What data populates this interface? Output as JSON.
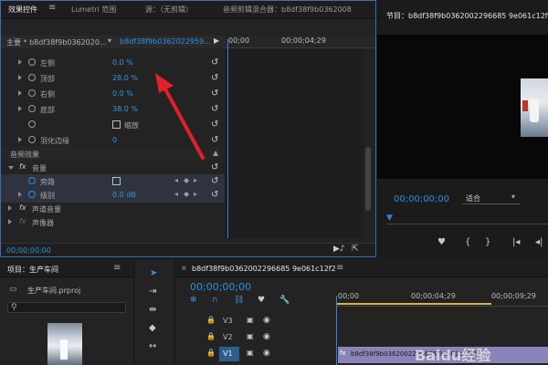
{
  "effect_controls": {
    "tabs": [
      "效果控件",
      "Lumetri 范围",
      "源：（无剪辑）",
      "音频剪辑混合器：b8df38f9b0362008"
    ],
    "header_master": "主要 * b8df38f9b0362020...",
    "header_clip": "b8df38f9b0362022959...",
    "ruler_start": "00;00",
    "ruler_mid": "00;00;04;29",
    "rows": [
      {
        "label": "左侧",
        "value": "0.0 %"
      },
      {
        "label": "顶部",
        "value": "28.0 %"
      },
      {
        "label": "右侧",
        "value": "0.0 %"
      },
      {
        "label": "底部",
        "value": "38.0 %"
      },
      {
        "label": "",
        "checkbox": "缩放"
      },
      {
        "label": "羽化边缘",
        "value": "0"
      }
    ],
    "audio_section": "音频效果",
    "volume": {
      "label": "音量",
      "bypass": "旁路",
      "level": "级别",
      "level_value": "0.0 dB"
    },
    "channel_volume": "声道音量",
    "panner": "声像器",
    "footer_time": "00;00;00;00"
  },
  "program": {
    "title": "节目：b8df38f9b0362002296685 9e061c12f2",
    "timecode": "00;00;00;00",
    "fit": "适合"
  },
  "project": {
    "title": "项目：生产车间",
    "file": "生产车间.prproj"
  },
  "timeline": {
    "title": "b8df38f9b0362002296685 9e061c12f2",
    "timecode": "00;00;00;00",
    "ruler": [
      "00;00",
      "00;00;04;29",
      "00;00;09;29"
    ],
    "tracks": [
      "V3",
      "V2",
      "V1"
    ],
    "clip": "b8df38f9b0362002296685 9e061c12f2"
  },
  "watermark": "Baidu经验",
  "colors": {
    "accent": "#2e8fdd",
    "arrow": "#e0202a",
    "playhead": "#3a7bdc"
  }
}
